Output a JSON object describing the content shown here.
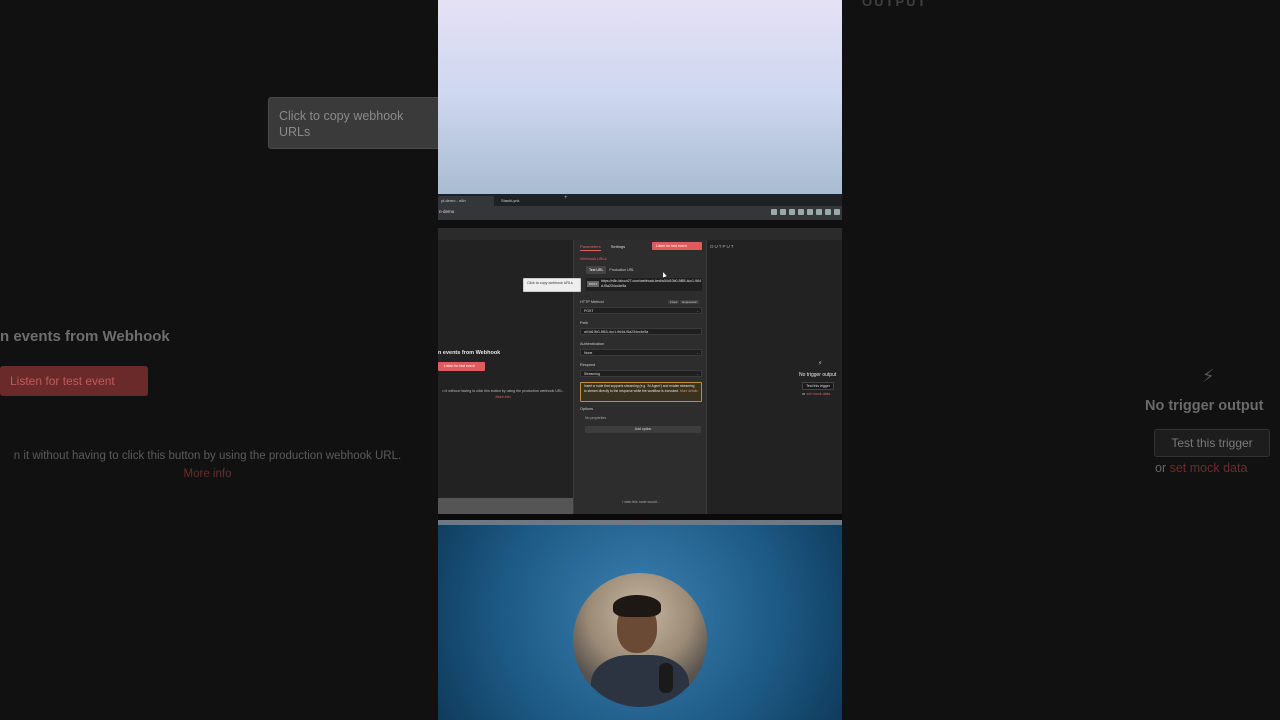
{
  "background": {
    "tooltip": "Click to copy webhook URLs",
    "title": "n events from Webhook",
    "listen_button": "Listen for test event",
    "hint": "n it without having to click this button by using the production webhook URL.",
    "hint_link": "More info",
    "output_label": "OUTPUT",
    "no_trigger": "No trigger output",
    "test_trigger": "Test this trigger",
    "or": "or",
    "mock_link": "set mock data"
  },
  "browser": {
    "tabs": [
      {
        "label": "yt-demo - n8n"
      },
      {
        "label": "StashLynk"
      }
    ],
    "address": "n-demo"
  },
  "left_pane": {
    "title": "n events from Webhook",
    "listen_button": "Listen for test event",
    "hint": "n it without having to click this button by using the production webhook URL.",
    "hint_link": "More info"
  },
  "params": {
    "tab_parameters": "Parameters",
    "tab_settings": "Settings",
    "listen_button": "Listen for test event",
    "webhook_urls_label": "Webhook URLs",
    "test_url": "Test URL",
    "production_url": "Production URL",
    "method_badge": "POST",
    "url_value": "https://n8n.falcon27.com/webhook-test/a04d10b0-5f85-4cc1-964d-f5a234cc4e5a",
    "http_method_label": "HTTP Method",
    "fixed": "Fixed",
    "expression": "Expression",
    "http_method_value": "POST",
    "path_label": "Path",
    "path_value": "a04d10b0-5f63-4cc1-964d-f5a234cc4e5a",
    "auth_label": "Authentication",
    "auth_value": "None",
    "respond_label": "Respond",
    "respond_value": "Streaming",
    "notice": "Insert a node that supports streaming (e.g. 'AI Agent') and enable streaming to stream directly to the response while the workflow is executed.",
    "notice_link": "More details",
    "options_label": "Options",
    "no_properties": "No properties",
    "add_option": "Add option",
    "wish": "I wish this node would..."
  },
  "tooltip": "Click to copy webhook URLs",
  "output": {
    "label": "OUTPUT",
    "no_trigger": "No trigger output",
    "test_trigger": "Test this trigger",
    "or": "or",
    "mock_link": "set mock data"
  },
  "colors": {
    "accent": "#e05c5c",
    "warning_border": "#c48a3c"
  }
}
